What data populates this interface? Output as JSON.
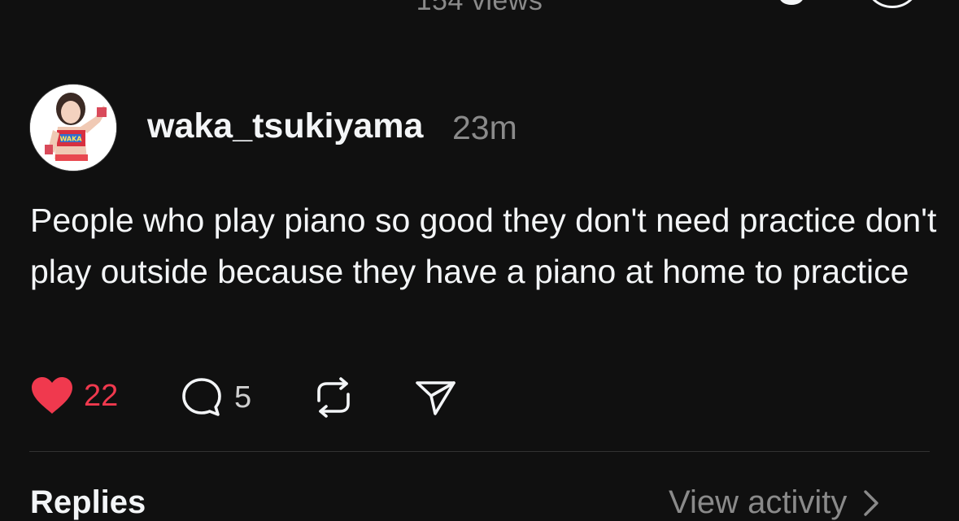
{
  "header": {
    "views_label": "154 views"
  },
  "post": {
    "username": "waka_tsukiyama",
    "timestamp": "23m",
    "text": "People who play piano so good they don't need practice don't play outside because they have a piano at home to practice",
    "avatar_icon": "profile-photo"
  },
  "actions": {
    "like_count": "22",
    "reply_count": "5",
    "like_icon": "heart-filled-icon",
    "reply_icon": "speech-bubble-icon",
    "repost_icon": "repost-icon",
    "share_icon": "send-icon",
    "like_color": "#f0394e"
  },
  "replies_section": {
    "title": "Replies",
    "view_activity_label": "View activity"
  },
  "colors": {
    "background": "#101010",
    "text_primary": "#f3f5f7",
    "text_secondary": "#8a8a8a",
    "divider": "#323232"
  }
}
